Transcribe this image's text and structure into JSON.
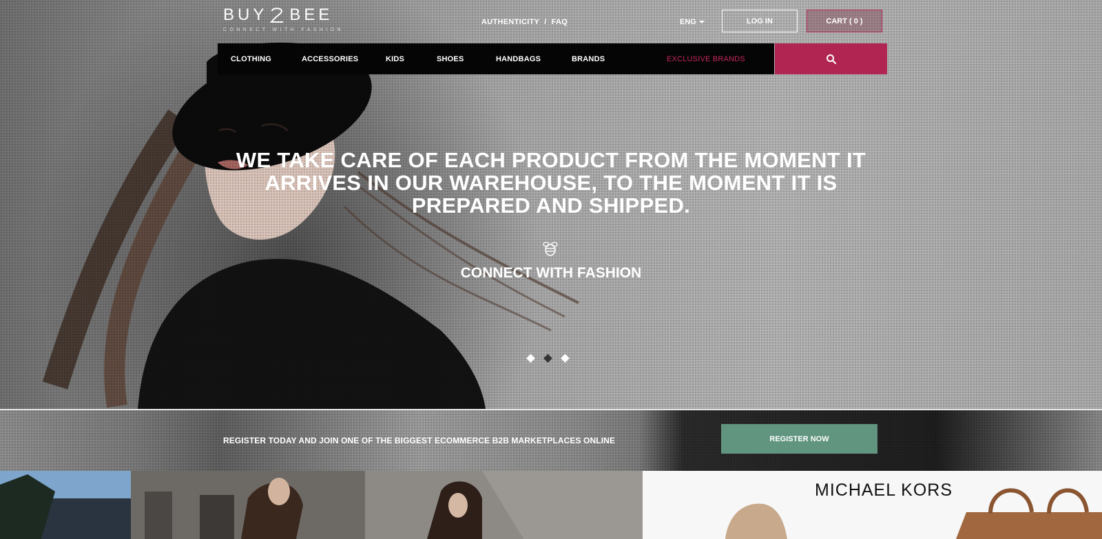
{
  "brand": {
    "logo_text_left": "BUY",
    "logo_text_right": "BEE",
    "logo_tagline": "CONNECT WITH FASHION"
  },
  "header": {
    "links": [
      "AUTHENTICITY",
      "/",
      "FAQ"
    ],
    "language": "ENG",
    "login_label": "LOG IN",
    "cart_label": "CART ( 0 )"
  },
  "nav": {
    "items": [
      "CLOTHING",
      "ACCESSORIES",
      "KIDS",
      "SHOES",
      "HANDBAGS",
      "BRANDS"
    ],
    "exclusive_label": "EXCLUSIVE BRANDS",
    "search_icon": "search-icon"
  },
  "hero": {
    "headline": "WE TAKE CARE OF EACH PRODUCT FROM THE MOMENT IT ARRIVES IN OUR WAREHOUSE, TO THE MOMENT IT IS PREPARED AND SHIPPED.",
    "icon": "bee-icon",
    "tagline": "CONNECT WITH FASHION",
    "slides_total": 3,
    "active_slide": 2
  },
  "register_strip": {
    "text": "REGISTER TODAY AND JOIN ONE OF THE BIGGEST ECOMMERCE B2B MARKETPLACES ONLINE",
    "button_label": "REGISTER NOW"
  },
  "tiles": {
    "right_brand": "MICHAEL KORS"
  },
  "colors": {
    "accent": "#b02552",
    "register_green": "#619580",
    "nav_bg": "#050505"
  }
}
